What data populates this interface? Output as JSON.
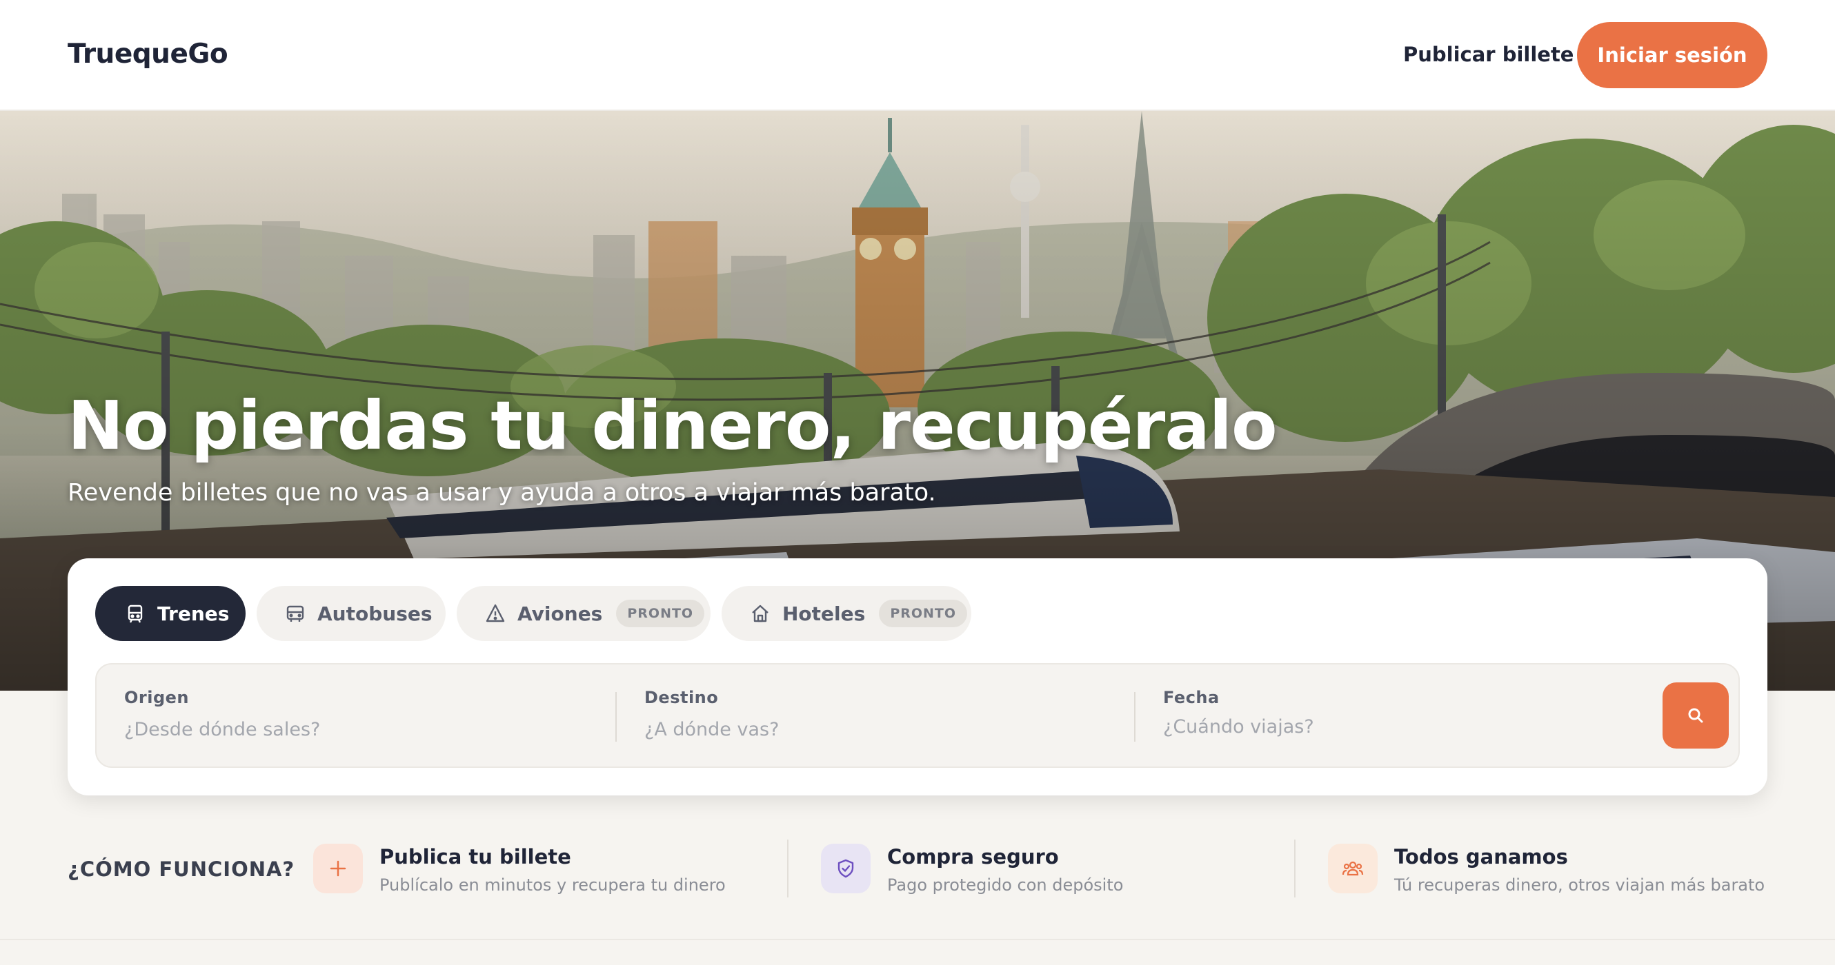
{
  "header": {
    "logo": "TruequeGo",
    "publish_link": "Publicar billete",
    "login_button": "Iniciar sesión"
  },
  "hero": {
    "title": "No pierdas tu dinero, recupéralo",
    "subtitle": "Revende billetes que no vas a usar y ayuda a otros a viajar más barato."
  },
  "search": {
    "tabs": [
      {
        "label": "Trenes",
        "icon": "train-icon",
        "active": true,
        "badge": ""
      },
      {
        "label": "Autobuses",
        "icon": "bus-icon",
        "active": false,
        "badge": ""
      },
      {
        "label": "Aviones",
        "icon": "plane-icon",
        "active": false,
        "badge": "PRONTO"
      },
      {
        "label": "Hoteles",
        "icon": "home-icon",
        "active": false,
        "badge": "PRONTO"
      }
    ],
    "origin": {
      "label": "Origen",
      "placeholder": "¿Desde dónde sales?"
    },
    "destination": {
      "label": "Destino",
      "placeholder": "¿A dónde vas?"
    },
    "date": {
      "label": "Fecha",
      "placeholder": "¿Cuándo viajas?"
    },
    "button_icon": "search-icon"
  },
  "how_it_works": {
    "title": "¿CÓMO FUNCIONA?",
    "steps": [
      {
        "title": "Publica tu billete",
        "description": "Publícalo en minutos y recupera tu dinero",
        "icon": "plus-icon"
      },
      {
        "title": "Compra seguro",
        "description": "Pago protegido con depósito",
        "icon": "shield-icon"
      },
      {
        "title": "Todos ganamos",
        "description": "Tú recuperas dinero, otros viajan más barato",
        "icon": "people-icon"
      }
    ]
  },
  "colors": {
    "accent": "#ea7245",
    "dark": "#232838",
    "background": "#f6f4f0"
  }
}
